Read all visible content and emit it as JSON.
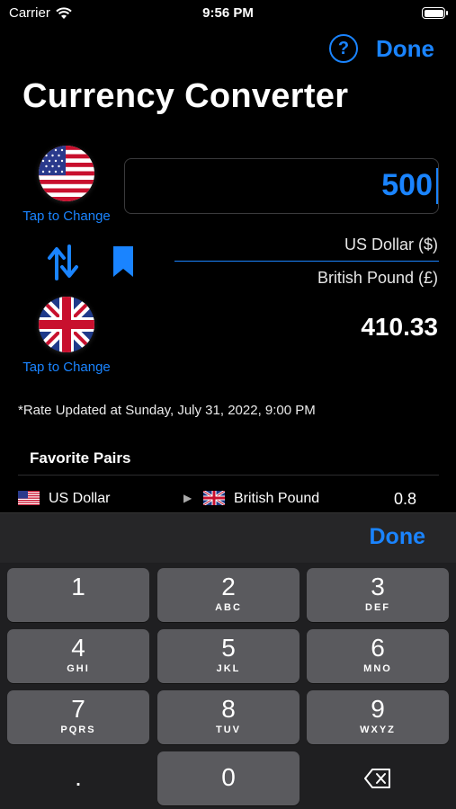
{
  "status": {
    "carrier": "Carrier",
    "time": "9:56 PM",
    "battery_level": 1.0
  },
  "nav": {
    "help": "?",
    "done": "Done"
  },
  "page_title": "Currency Converter",
  "converter": {
    "from_tap_label": "Tap to Change",
    "to_tap_label": "Tap to Change",
    "amount": "500",
    "from_currency": "US Dollar ($)",
    "to_currency": "British Pound (£)",
    "result": "410.33",
    "rate_updated": "*Rate Updated at Sunday, July 31, 2022, 9:00 PM",
    "icons": {
      "from_flag": "us-flag-icon",
      "to_flag": "uk-flag-icon",
      "swap": "swap-arrows-icon",
      "bookmark": "bookmark-icon"
    }
  },
  "favorites": {
    "title": "Favorite Pairs",
    "rows": [
      {
        "from": "US Dollar",
        "arrow": "▶",
        "to": "British Pound",
        "rate": "0.8"
      }
    ]
  },
  "keyboard": {
    "done": "Done",
    "keys": [
      {
        "num": "1",
        "letters": ""
      },
      {
        "num": "2",
        "letters": "ABC"
      },
      {
        "num": "3",
        "letters": "DEF"
      },
      {
        "num": "4",
        "letters": "GHI"
      },
      {
        "num": "5",
        "letters": "JKL"
      },
      {
        "num": "6",
        "letters": "MNO"
      },
      {
        "num": "7",
        "letters": "PQRS"
      },
      {
        "num": "8",
        "letters": "TUV"
      },
      {
        "num": "9",
        "letters": "WXYZ"
      },
      {
        "num": ".",
        "letters": ""
      },
      {
        "num": "0",
        "letters": ""
      },
      {
        "num": "⌫",
        "letters": ""
      }
    ]
  },
  "colors": {
    "accent": "#1a84ff",
    "background": "#000000",
    "key": "#5a5a5e"
  }
}
